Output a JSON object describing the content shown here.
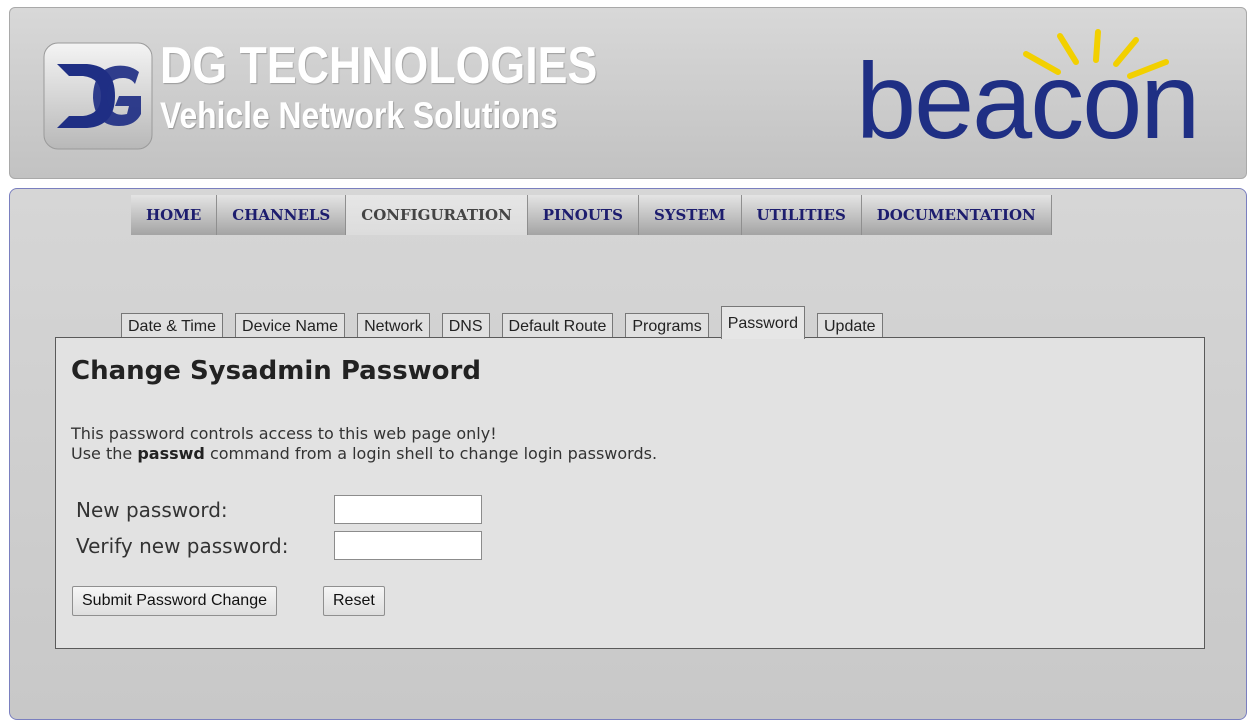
{
  "header": {
    "company_name": "DG TECHNOLOGIES",
    "company_tagline": "Vehicle Network Solutions",
    "product_logo_text": "beacon",
    "dg_logo_icon": "dg-monogram-logo",
    "accent_navy": "#1f2f84",
    "ray_color": "#f2d000"
  },
  "nav": {
    "tabs": [
      {
        "label": "HOME"
      },
      {
        "label": "CHANNELS"
      },
      {
        "label": "CONFIGURATION",
        "active": true
      },
      {
        "label": "PINOUTS"
      },
      {
        "label": "SYSTEM"
      },
      {
        "label": "UTILITIES"
      },
      {
        "label": "DOCUMENTATION"
      }
    ]
  },
  "subtabs": [
    {
      "label": "Date & Time"
    },
    {
      "label": "Device Name"
    },
    {
      "label": "Network"
    },
    {
      "label": "DNS"
    },
    {
      "label": "Default Route"
    },
    {
      "label": "Programs"
    },
    {
      "label": "Password",
      "active": true
    },
    {
      "label": "Update"
    }
  ],
  "page": {
    "title": "Change Sysadmin Password",
    "info_line1": "This password controls access to this web page only!",
    "info_line2_prefix": "Use the ",
    "info_line2_command": "passwd",
    "info_line2_suffix": " command from a login shell to change login passwords."
  },
  "form": {
    "new_password_label": "New password:",
    "new_password_value": "",
    "verify_password_label": "Verify new password:",
    "verify_password_value": "",
    "submit_label": "Submit Password Change",
    "reset_label": "Reset"
  }
}
